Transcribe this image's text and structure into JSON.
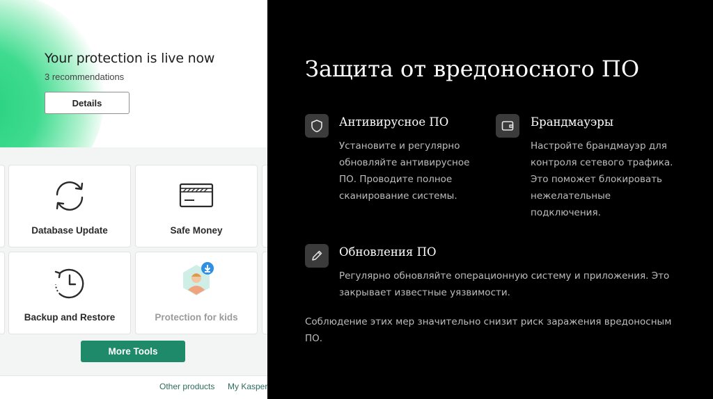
{
  "app": {
    "hero": {
      "title": "Your protection is live now",
      "subtitle": "3 recommendations",
      "details_label": "Details"
    },
    "tiles": [
      {
        "label": "Database Update",
        "icon": "refresh-icon",
        "muted": false
      },
      {
        "label": "Safe Money",
        "icon": "credit-card-icon",
        "muted": false
      },
      {
        "label": "Backup and Restore",
        "icon": "backup-clock-icon",
        "muted": false
      },
      {
        "label": "Protection for kids",
        "icon": "kid-avatar-icon",
        "muted": true
      }
    ],
    "more_tools_label": "More Tools",
    "footer": {
      "links": [
        "Other products",
        "My Kasper"
      ]
    },
    "colors": {
      "accent_green": "#1e8a6a",
      "hero_gradient": "#25d07c",
      "download_badge": "#2f8fe0"
    }
  },
  "slide": {
    "title": "Защита от вредоносного ПО",
    "features": [
      {
        "icon": "shield-icon",
        "title": "Антивирусное ПО",
        "lines": [
          "Установите и регулярно",
          "обновляйте антивирусное",
          "ПО. Проводите полное",
          "сканирование системы."
        ]
      },
      {
        "icon": "wallet-icon",
        "title": "Брандмауэры",
        "lines": [
          "Настройте брандмауэр для",
          "контроля сетевого трафика.",
          "Это поможет блокировать",
          "нежелательные",
          "подключения."
        ]
      },
      {
        "icon": "pencil-icon",
        "title": "Обновления ПО",
        "lines": [
          "Регулярно обновляйте операционную систему и приложения. Это",
          "закрывает известные уязвимости."
        ]
      }
    ],
    "summary_lines": [
      "Соблюдение этих мер значительно снизит риск заражения вредоносным",
      "ПО."
    ],
    "colors": {
      "background": "#000000",
      "icon_box": "#3b3b3b",
      "body_text": "#bdbdbd"
    }
  }
}
